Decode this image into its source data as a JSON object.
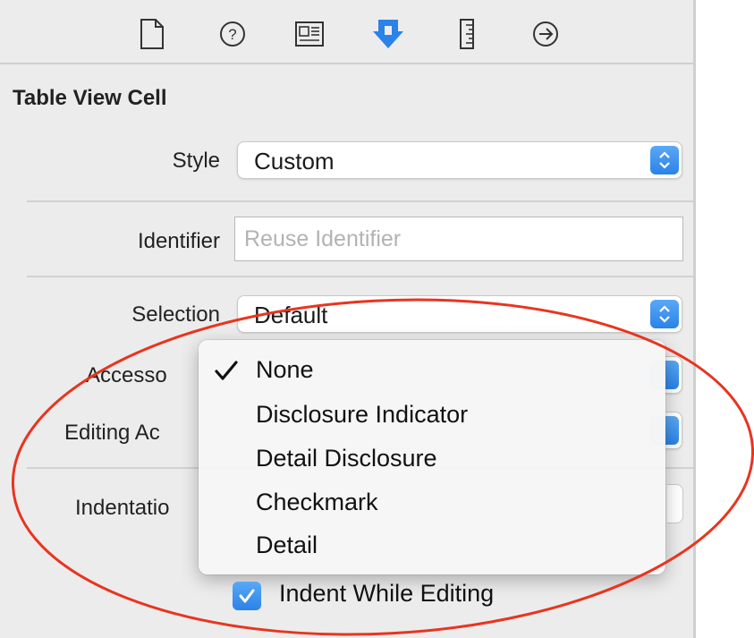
{
  "inspector_tabs": [
    {
      "name": "file-inspector-icon"
    },
    {
      "name": "quick-help-icon"
    },
    {
      "name": "identity-inspector-icon"
    },
    {
      "name": "attributes-inspector-icon",
      "selected": true
    },
    {
      "name": "size-inspector-icon"
    },
    {
      "name": "connections-inspector-icon"
    }
  ],
  "section": {
    "title": "Table View Cell"
  },
  "fields": {
    "style": {
      "label": "Style",
      "value": "Custom"
    },
    "identifier": {
      "label": "Identifier",
      "placeholder": "Reuse Identifier"
    },
    "selection": {
      "label": "Selection",
      "value": "Default"
    },
    "accessory": {
      "label": "Accesso"
    },
    "editing_accessory": {
      "label": "Editing Ac"
    },
    "indentation": {
      "label": "Indentatio"
    }
  },
  "accessory_menu": {
    "selected": "None",
    "items": [
      "None",
      "Disclosure Indicator",
      "Detail Disclosure",
      "Checkmark",
      "Detail"
    ]
  },
  "indent_while_editing": {
    "label": "Indent While Editing",
    "checked": true
  },
  "colors": {
    "accent": "#2b82e8",
    "annotation": "#e8351f",
    "panel": "#ececec"
  }
}
